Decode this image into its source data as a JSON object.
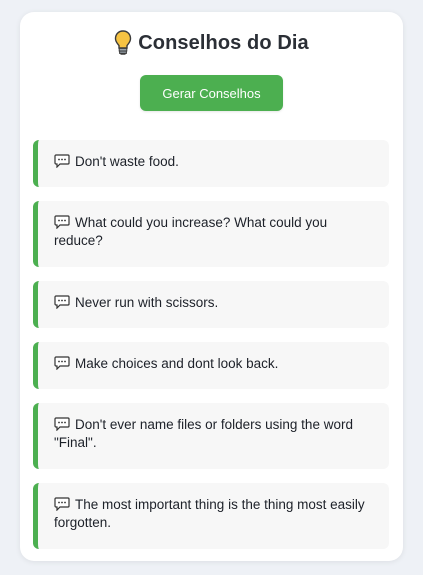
{
  "header": {
    "title": "Conselhos do Dia"
  },
  "actions": {
    "generate_label": "Gerar Conselhos"
  },
  "advice_list": [
    "Don't waste food.",
    "What could you increase? What could you reduce?",
    "Never run with scissors.",
    "Make choices and dont look back.",
    "Don't ever name files or folders using the word \"Final\".",
    "The most important thing is the thing most easily forgotten."
  ],
  "icons": {
    "title_icon": "lightbulb-icon",
    "item_icon": "speech-bubble-icon"
  },
  "colors": {
    "accent": "#4caf50",
    "background": "#eef1f6",
    "card": "#ffffff",
    "item_background": "#f7f7f7"
  }
}
